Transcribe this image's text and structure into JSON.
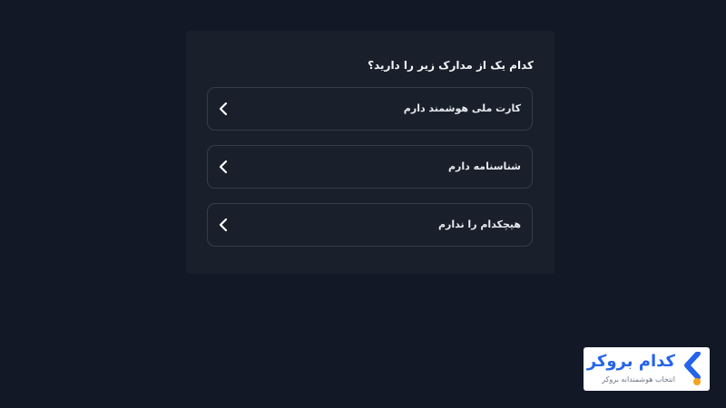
{
  "question": {
    "text": "کدام یک از مدارک زیر را دارید؟"
  },
  "options": [
    {
      "label": "کارت ملی هوشمند دارم",
      "icon": "chevron-left-icon"
    },
    {
      "label": "شناسنامه دارم",
      "icon": "chevron-left-icon"
    },
    {
      "label": "هیچکدام را ندارم",
      "icon": "chevron-left-icon"
    }
  ],
  "brand": {
    "name": "کدام بروکر",
    "tagline": "انتخاب هوشمندانه بروکر",
    "icon": "kadam-broker-logo-icon",
    "colors": {
      "primary": "#2563eb",
      "accent": "#f4a51c"
    }
  },
  "theme": {
    "background": "#121826",
    "card": "#1a202b",
    "border": "#363c48",
    "text": "#e7eaef"
  }
}
